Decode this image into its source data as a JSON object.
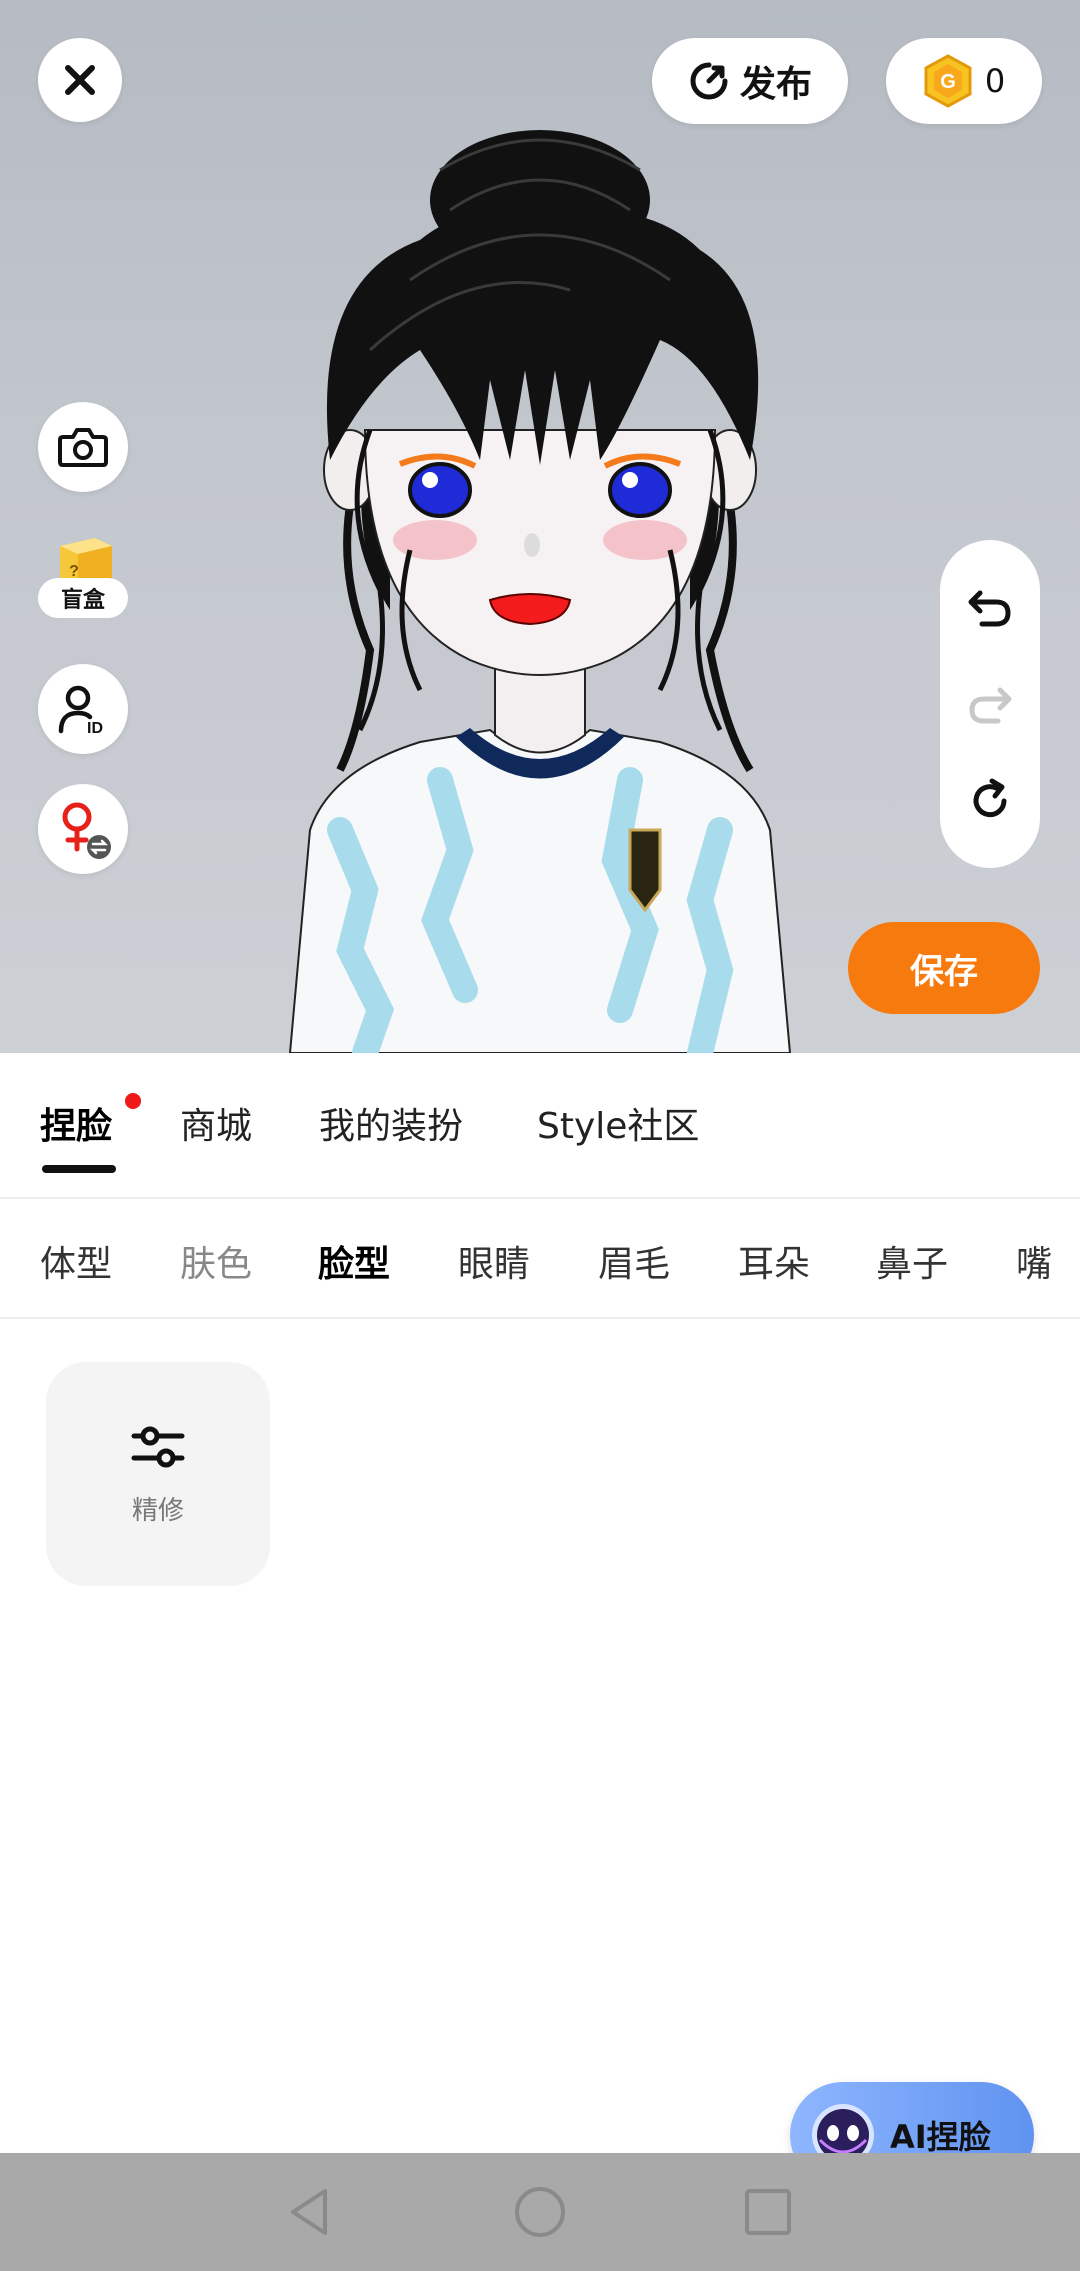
{
  "toolbar": {
    "close_icon": "close-icon",
    "publish_label": "发布",
    "coin_count": "0"
  },
  "side_tools": {
    "camera_icon": "camera-icon",
    "blindbox_label": "盲盒",
    "profile_icon": "profile-id-icon",
    "gender_icon": "gender-switch-icon"
  },
  "history": {
    "undo_icon": "undo-icon",
    "redo_icon": "redo-icon",
    "reset_icon": "reset-icon"
  },
  "save_label": "保存",
  "main_tabs": [
    {
      "label": "捏脸",
      "active": true,
      "badge": true
    },
    {
      "label": "商城"
    },
    {
      "label": "我的装扮"
    },
    {
      "label": "Style社区"
    }
  ],
  "sub_tabs": [
    {
      "label": "体型"
    },
    {
      "label": "肤色"
    },
    {
      "label": "脸型",
      "active": true
    },
    {
      "label": "眼睛"
    },
    {
      "label": "眉毛"
    },
    {
      "label": "耳朵"
    },
    {
      "label": "鼻子"
    },
    {
      "label": "嘴"
    }
  ],
  "refine": {
    "label": "精修",
    "icon": "sliders-icon"
  },
  "ai_button": {
    "label": "AI捏脸"
  },
  "colors": {
    "accent": "#f77a0f",
    "badge": "#f01818",
    "ai_gradient": [
      "#8fb6ff",
      "#5f93f0"
    ]
  }
}
